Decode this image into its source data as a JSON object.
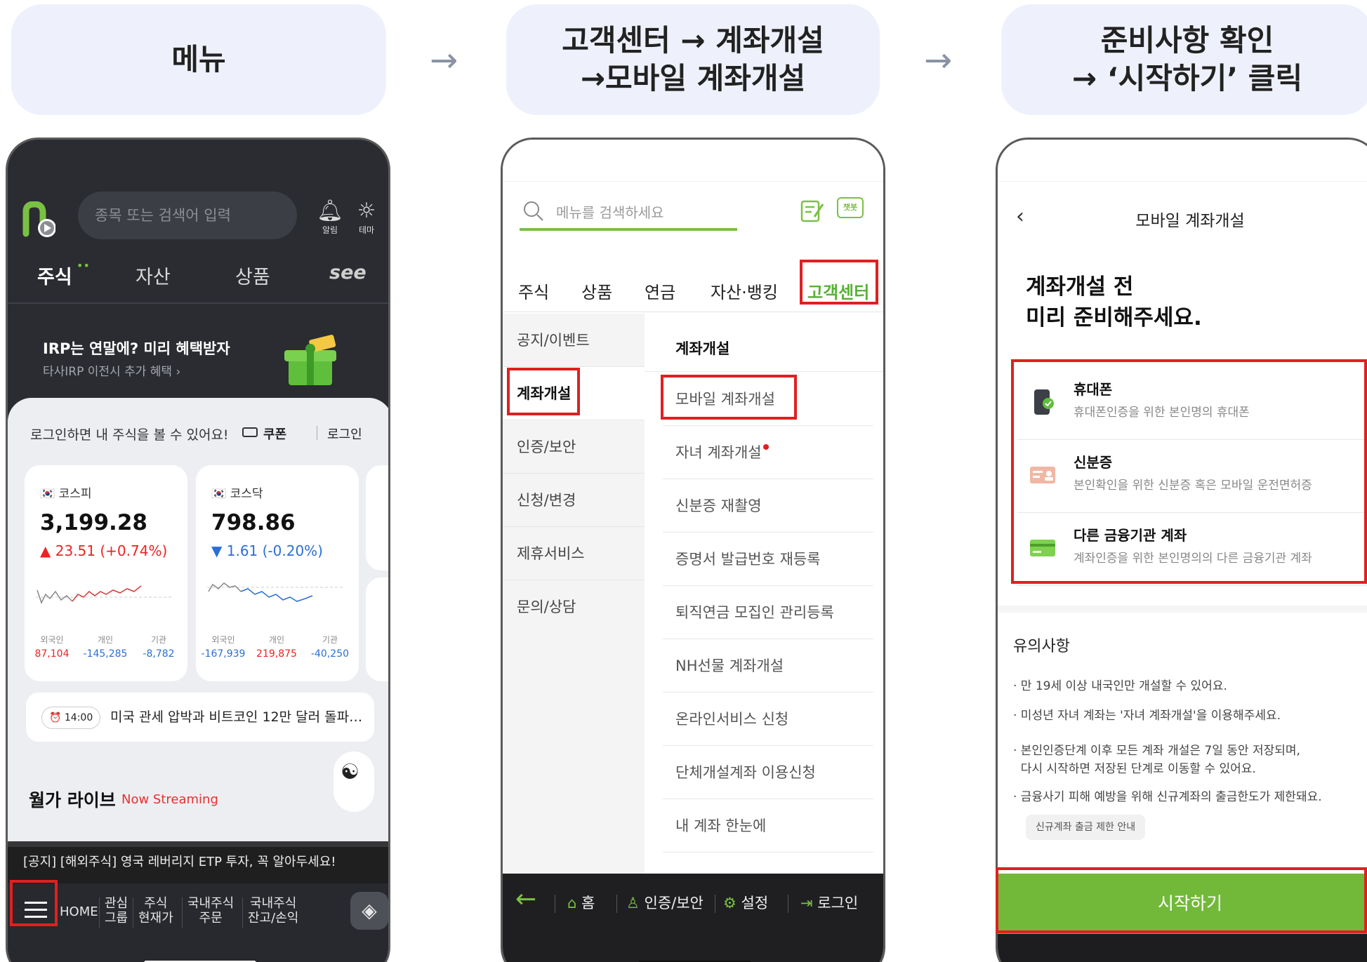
{
  "steps": [
    {
      "line1": "메뉴",
      "line2": ""
    },
    {
      "line1": "고객센터 → 계좌개설",
      "line2": "→모바일 계좌개설"
    },
    {
      "line1": "준비사항 확인",
      "line2": "→ ‘시작하기’ 클릭"
    }
  ],
  "arrow": "→",
  "phone1": {
    "search_placeholder": "종목 또는 검색어 입력",
    "alarm_label": "알림",
    "theme_label": "테마",
    "tabs": [
      "주식",
      "자산",
      "상품",
      "see"
    ],
    "banner_title": "IRP는 연말에? 미리 혜택받자",
    "banner_sub": "타사IRP 이전시 추가 혜택 ›",
    "login_msg": "로그인하면 내 주식을 볼 수 있어요!",
    "coupon": "쿠폰",
    "login": "로그인",
    "cards": [
      {
        "name": "코스피",
        "value": "3,199.28",
        "change": "▲ 23.51 (+0.74%)",
        "dir": "up",
        "investors": [
          {
            "label": "외국인",
            "value": "87,104",
            "color": "#e22"
          },
          {
            "label": "개인",
            "value": "-145,285",
            "color": "#2a6fd6"
          },
          {
            "label": "기관",
            "value": "-8,782",
            "color": "#2a6fd6"
          }
        ]
      },
      {
        "name": "코스닥",
        "value": "798.86",
        "change": "▼ 1.61 (-0.20%)",
        "dir": "dn",
        "investors": [
          {
            "label": "외국인",
            "value": "-167,939",
            "color": "#2a6fd6"
          },
          {
            "label": "개인",
            "value": "219,875",
            "color": "#e22"
          },
          {
            "label": "기관",
            "value": "-40,250",
            "color": "#2a6fd6"
          }
        ]
      }
    ],
    "news_time": "14:00",
    "news_text": "미국 관세 압박과 비트코인 12만 달러 돌파…",
    "live_title": "월가 라이브",
    "live_stream": "Now Streaming",
    "notice": "[공지] [해외주식] 영국 레버리지 ETP 투자, 꼭 알아두세요!",
    "nav": {
      "home": "HOME",
      "items": [
        [
          "관심",
          "그룹"
        ],
        [
          "주식",
          "현재가"
        ],
        [
          "국내주식",
          "주문"
        ],
        [
          "국내주식",
          "잔고/손익"
        ]
      ]
    }
  },
  "phone2": {
    "search_placeholder": "메뉴를 검색하세요",
    "chatbot": "챗봇",
    "tabs": [
      "주식",
      "상품",
      "연금",
      "자산·뱅킹",
      "고객센터"
    ],
    "left_items": [
      "공지/이벤트",
      "계좌개설",
      "인증/보안",
      "신청/변경",
      "제휴서비스",
      "문의/상담"
    ],
    "right_header": "계좌개설",
    "right_items": [
      "모바일 계좌개설",
      "자녀 계좌개설",
      "신분증 재촬영",
      "증명서 발급번호 재등록",
      "퇴직연금 모집인 관리등록",
      "NH선물 계좌개설",
      "온라인서비스 신청",
      "단체개설계좌 이용신청",
      "내 계좌 한눈에"
    ],
    "nav": {
      "home": "홈",
      "auth": "인증/보안",
      "settings": "설정",
      "login": "로그인"
    }
  },
  "phone3": {
    "title": "모바일 계좌개설",
    "heading_line1": "계좌개설 전",
    "heading_line2": "미리 준비해주세요.",
    "prep": [
      {
        "title": "휴대폰",
        "desc": "휴대폰인증을 위한 본인명의 휴대폰"
      },
      {
        "title": "신분증",
        "desc": "본인확인을 위한 신분증 혹은 모바일 운전면허증"
      },
      {
        "title": "다른 금융기관 계좌",
        "desc": "계좌인증을 위한 본인명의의 다른 금융기관 계좌"
      }
    ],
    "notes_title": "유의사항",
    "notes": [
      "· 만 19세 이상 내국인만 개설할 수 있어요.",
      "· 미성년 자녀 계좌는 '자녀 계좌개설'을 이용해주세요.",
      "· 본인인증단계 이후 모든 계좌 개설은 7일 동안 저장되며,",
      "  다시 시작하면 저장된 단계로 이동할 수 있어요.",
      "· 금융사기 피해 예방을 위해 신규계좌의 출금한도가 제한돼요."
    ],
    "chip": "신규계좌 출금 제한 안내",
    "cta": "시작하기"
  },
  "colors": {
    "accent_green": "#72b93a",
    "highlight_red": "#e02020",
    "step_bg": "#eef1fb"
  }
}
